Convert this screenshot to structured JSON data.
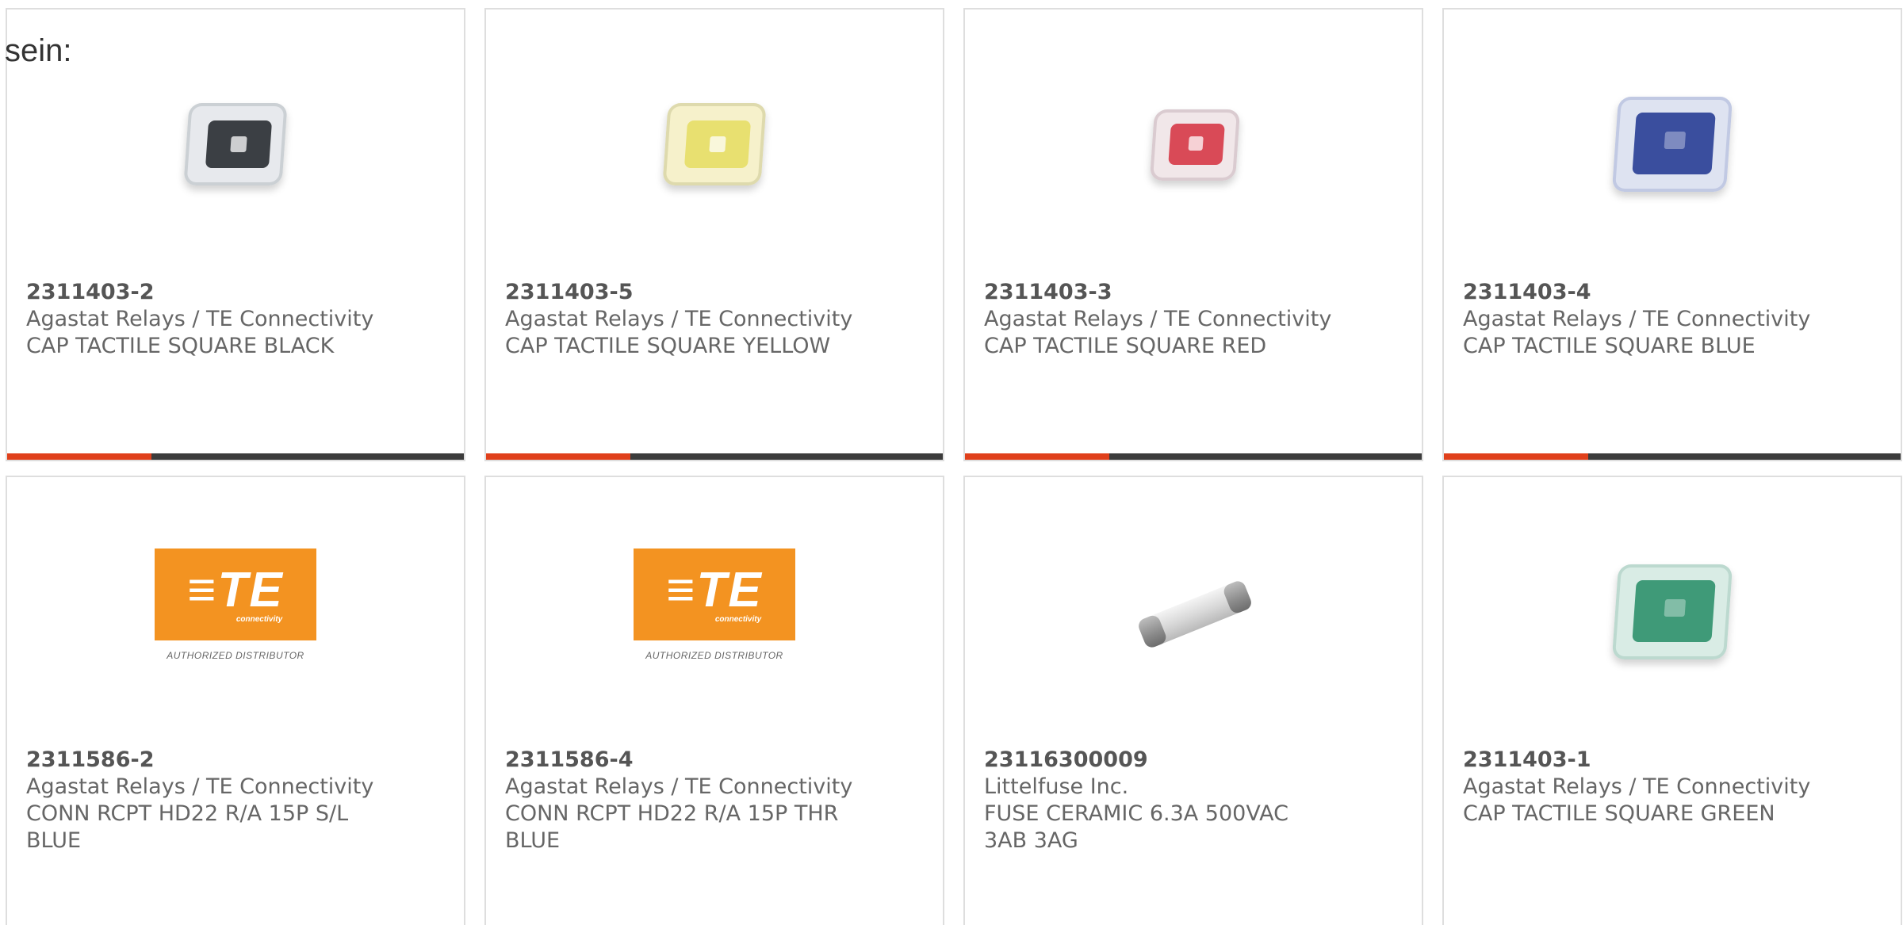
{
  "intro_text": "sein:",
  "colors": {
    "accent": "#e0401b",
    "bar_dark": "#3c3c3c",
    "te_orange": "#f39321"
  },
  "products": [
    {
      "part": "2311403-2",
      "manufacturer": "Agastat Relays / TE Connectivity",
      "description": "CAP TACTILE SQUARE BLACK",
      "image": "black-cap",
      "color": "#3b3f44"
    },
    {
      "part": "2311403-5",
      "manufacturer": "Agastat Relays / TE Connectivity",
      "description": "CAP TACTILE SQUARE YELLOW",
      "image": "yellow-cap",
      "color": "#e8e070"
    },
    {
      "part": "2311403-3",
      "manufacturer": "Agastat Relays / TE Connectivity",
      "description": "CAP TACTILE SQUARE RED",
      "image": "red-cap",
      "color": "#d94a57"
    },
    {
      "part": "2311403-4",
      "manufacturer": "Agastat Relays / TE Connectivity",
      "description": "CAP TACTILE SQUARE BLUE",
      "image": "blue-cap",
      "color": "#3a4e9e"
    },
    {
      "part": "2311586-2",
      "manufacturer": "Agastat Relays / TE Connectivity",
      "description": "CONN RCPT HD22 R/A 15P S/L BLUE",
      "image": "te-logo"
    },
    {
      "part": "2311586-4",
      "manufacturer": "Agastat Relays / TE Connectivity",
      "description": "CONN RCPT HD22 R/A 15P THR BLUE",
      "image": "te-logo"
    },
    {
      "part": "23116300009",
      "manufacturer": "Littelfuse Inc.",
      "description": "FUSE CERAMIC 6.3A 500VAC 3AB 3AG",
      "image": "fuse"
    },
    {
      "part": "2311403-1",
      "manufacturer": "Agastat Relays / TE Connectivity",
      "description": "CAP TACTILE SQUARE GREEN",
      "image": "green-cap",
      "color": "#3f9a78"
    }
  ],
  "te_logo": {
    "mark": "≡TE",
    "sub": "connectivity",
    "caption": "AUTHORIZED DISTRIBUTOR"
  }
}
